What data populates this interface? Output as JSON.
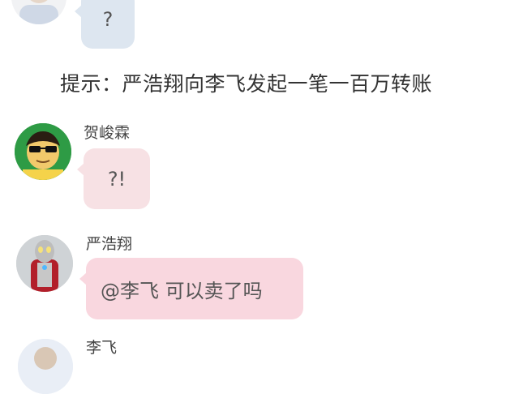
{
  "messages": [
    {
      "text": "?",
      "bubble_color": "#dde6f0"
    },
    {
      "text": "提示：严浩翔向李飞发起一笔一百万转账"
    },
    {
      "sender": "贺峻霖",
      "text": "?!",
      "bubble_color": "#f7e1e4"
    },
    {
      "sender": "严浩翔",
      "text": "@李飞 可以卖了吗",
      "bubble_color": "#f9d7df"
    },
    {
      "sender": "李飞"
    }
  ],
  "avatars": {
    "first": {
      "icon": "user-avatar-top-icon"
    },
    "he": {
      "icon": "cartoon-sunglasses-avatar-icon"
    },
    "yan": {
      "icon": "ultraman-avatar-icon"
    },
    "li": {
      "icon": "user-avatar-bottom-icon"
    }
  }
}
